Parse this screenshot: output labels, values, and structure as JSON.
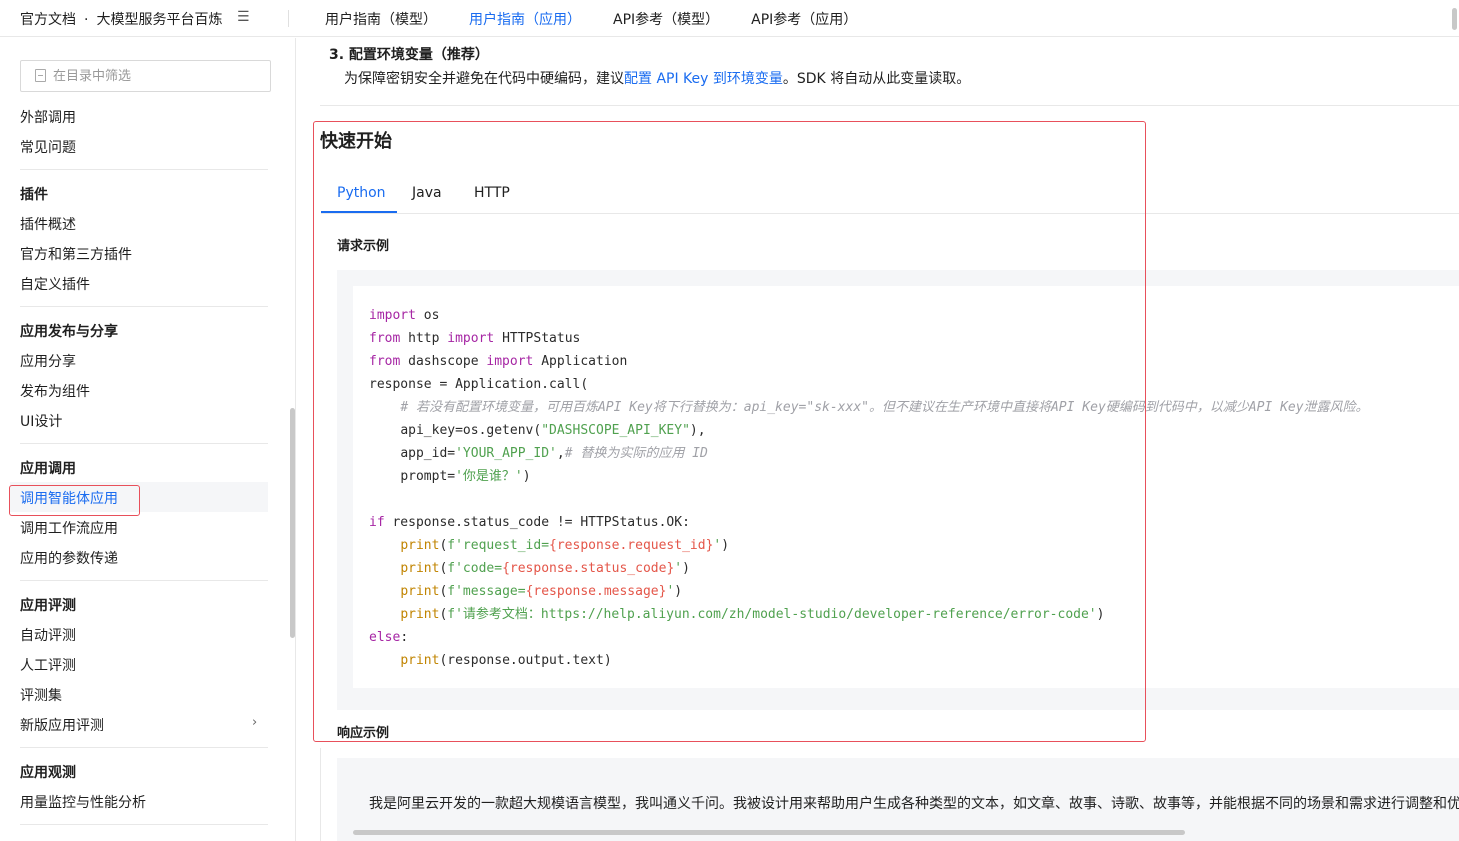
{
  "header": {
    "brand": "官方文档",
    "separator": "·",
    "product": "大模型服务平台百炼",
    "menu_icon": "hamburger-menu-icon",
    "nav": [
      {
        "label": "用户指南（模型）",
        "active": false
      },
      {
        "label": "用户指南（应用）",
        "active": true
      },
      {
        "label": "API参考（模型）",
        "active": false
      },
      {
        "label": "API参考（应用）",
        "active": false
      }
    ]
  },
  "sidebar": {
    "filter_placeholder": "在目录中筛选",
    "filter_icon": "document-filter-icon",
    "items_top": [
      "外部调用",
      "常见问题"
    ],
    "sections": [
      {
        "heading": "插件",
        "items": [
          "插件概述",
          "官方和第三方插件",
          "自定义插件"
        ]
      },
      {
        "heading": "应用发布与分享",
        "items": [
          "应用分享",
          "发布为组件",
          "UI设计"
        ]
      },
      {
        "heading": "应用调用",
        "items": [
          "调用智能体应用",
          "调用工作流应用",
          "应用的参数传递"
        ],
        "active": "调用智能体应用"
      },
      {
        "heading": "应用评测",
        "items": [
          "自动评测",
          "人工评测",
          "评测集",
          "新版应用评测"
        ]
      },
      {
        "heading": "应用观测",
        "items": [
          "用量监控与性能分析"
        ]
      }
    ],
    "chevron_icon": "chevron-right-icon"
  },
  "main": {
    "step_title": "3. 配置环境变量（推荐）",
    "step_desc_before": "为保障密钥安全并避免在代码中硬编码，建议",
    "step_desc_link": "配置 API Key 到环境变量",
    "step_desc_after": "。SDK 将自动从此变量读取。",
    "quick_title": "快速开始",
    "tabs": [
      {
        "label": "Python",
        "active": true
      },
      {
        "label": "Java",
        "active": false
      },
      {
        "label": "HTTP",
        "active": false
      }
    ],
    "request_title": "请求示例",
    "code": {
      "l1_kw": "import",
      "l1_rest": " os",
      "l2_kw1": "from",
      "l2_mid": " http ",
      "l2_kw2": "import",
      "l2_rest": " HTTPStatus",
      "l3_kw1": "from",
      "l3_mid": " dashscope ",
      "l3_kw2": "import",
      "l3_rest": " Application",
      "l4": "response = Application.call(",
      "l5_comment": "# 若没有配置环境变量，可用百炼API Key将下行替换为：api_key=\"sk-xxx\"。但不建议在生产环境中直接将API Key硬编码到代码中，以减少API Key泄露风险。",
      "l6_pre": "api_key=os.getenv(",
      "l6_str": "\"DASHSCOPE_API_KEY\"",
      "l6_post": "),",
      "l7_pre": "app_id=",
      "l7_str": "'YOUR_APP_ID'",
      "l7_post": ",",
      "l7_comment": "# 替换为实际的应用 ID",
      "l8_pre": "prompt=",
      "l8_str": "'你是谁？'",
      "l8_post": ")",
      "l10_kw": "if",
      "l10_rest": " response.status_code != HTTPStatus.OK:",
      "l11_fn": "print",
      "l11_open": "(",
      "l11_str1": "f'request_id=",
      "l11_var": "{response.request_id}",
      "l11_str2": "'",
      "l11_close": ")",
      "l12_fn": "print",
      "l12_open": "(",
      "l12_str1": "f'code=",
      "l12_var": "{response.status_code}",
      "l12_str2": "'",
      "l12_close": ")",
      "l13_fn": "print",
      "l13_open": "(",
      "l13_str1": "f'message=",
      "l13_var": "{response.message}",
      "l13_str2": "'",
      "l13_close": ")",
      "l14_fn": "print",
      "l14_open": "(",
      "l14_str": "f'请参考文档：https://help.aliyun.com/zh/model-studio/developer-reference/error-code'",
      "l14_close": ")",
      "l15_kw": "else",
      "l15_rest": ":",
      "l16_fn": "print",
      "l16_rest": "(response.output.text)"
    },
    "response_title": "响应示例",
    "response_text": "我是阿里云开发的一款超大规模语言模型，我叫通义千问。我被设计用来帮助用户生成各种类型的文本，如文章、故事、诗歌、故事等，并能根据不同的场景和需求进行调整和优化"
  }
}
